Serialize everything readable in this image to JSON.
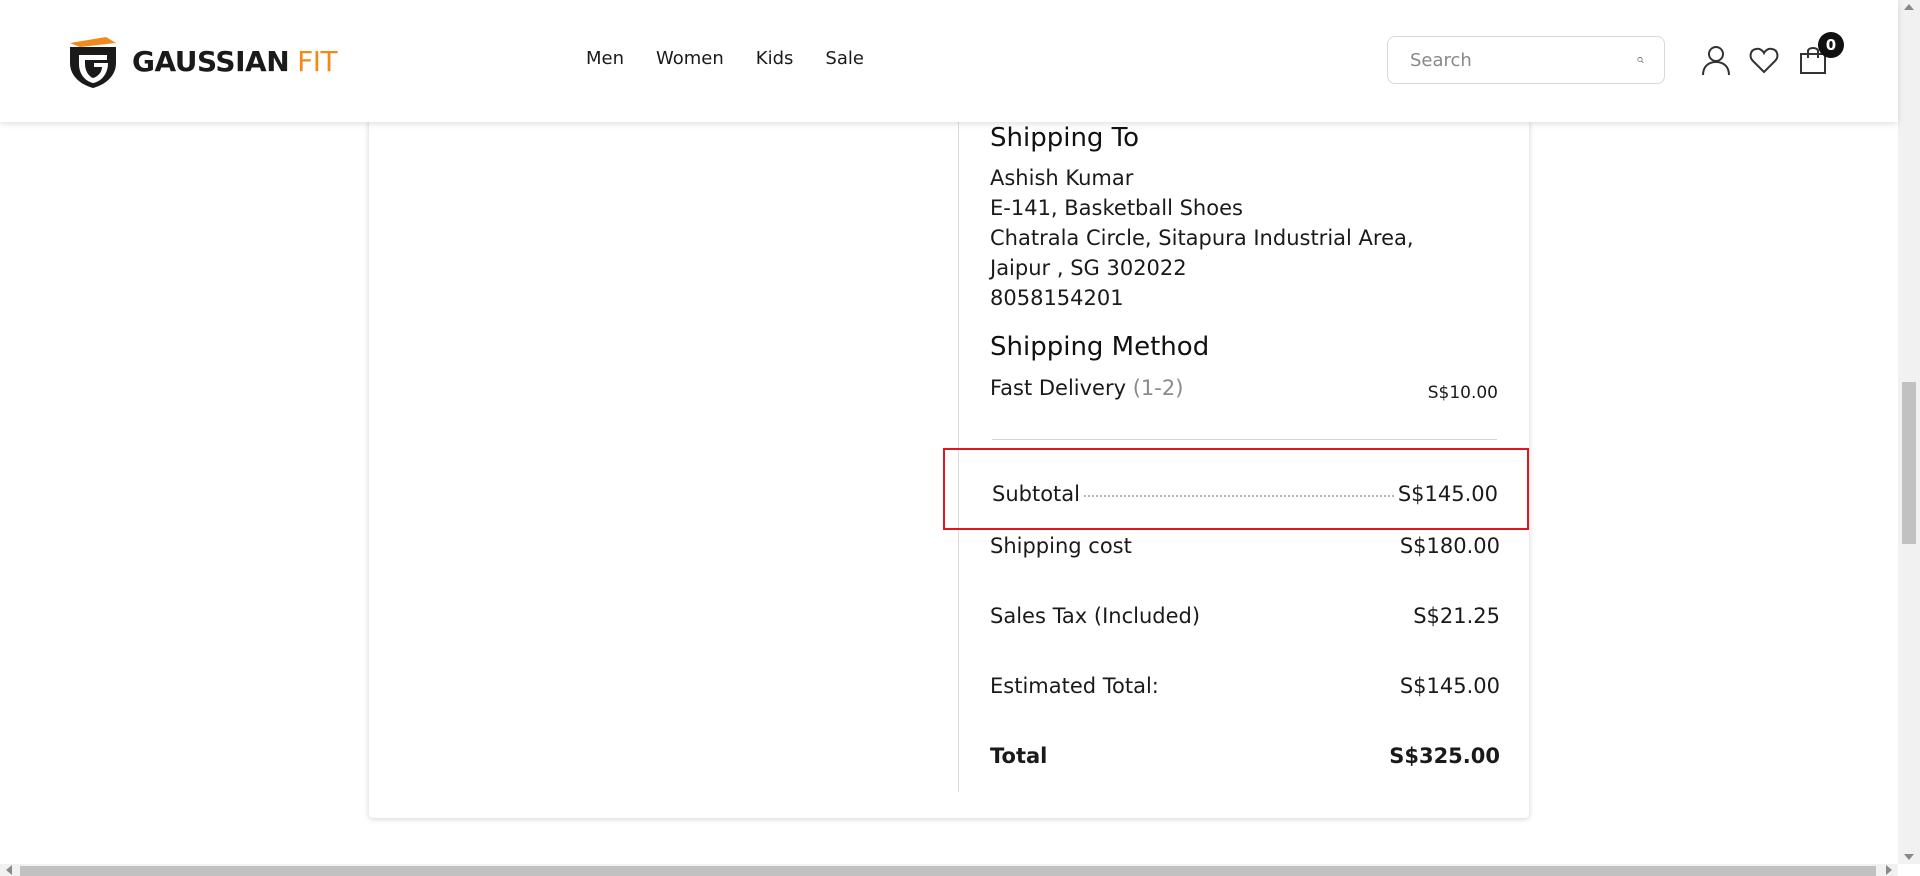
{
  "header": {
    "brand_part1": "GAUSSIAN",
    "brand_part2": "FIT",
    "nav": [
      "Men",
      "Women",
      "Kids",
      "Sale"
    ],
    "search_placeholder": "Search",
    "cart_count": "0",
    "icons": [
      "logo-icon",
      "search-icon",
      "user-icon",
      "heart-icon",
      "cart-icon"
    ],
    "accent_color": "#f28a1a"
  },
  "shipping_to": {
    "title": "Shipping To",
    "name": "Ashish Kumar",
    "address1": "E-141, Basketball Shoes",
    "address2": "Chatrala Circle, Sitapura Industrial Area,",
    "address3": "Jaipur , SG 302022",
    "phone": "8058154201"
  },
  "shipping_method": {
    "title": "Shipping Method",
    "name": "Fast Delivery",
    "days": "(1-2)",
    "price": "S$10.00"
  },
  "summary": {
    "subtotal_label": "Subtotal",
    "subtotal_value": "S$145.00",
    "shipping_label": "Shipping cost",
    "shipping_value": "S$180.00",
    "tax_label": "Sales Tax (Included)",
    "tax_value": "S$21.25",
    "estimated_label": "Estimated Total:",
    "estimated_value": "S$145.00",
    "total_label": "Total",
    "total_value": "S$325.00",
    "highlight_color": "#e0161e"
  }
}
